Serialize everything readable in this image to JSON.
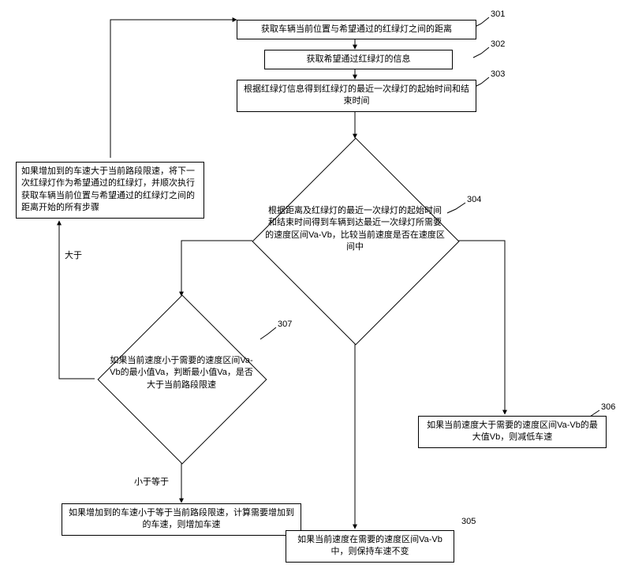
{
  "step301": {
    "num": "301",
    "text": "获取车辆当前位置与希望通过的红绿灯之间的距离"
  },
  "step302": {
    "num": "302",
    "text": "获取希望通过红绿灯的信息"
  },
  "step303": {
    "num": "303",
    "text": "根据红绿灯信息得到红绿灯的最近一次绿灯的起始时间和结束时间"
  },
  "step304": {
    "num": "304",
    "text": "根据距离及红绿灯的最近一次绿灯的起始时间和结束时间得到车辆到达最近一次绿灯所需要的速度区间Va-Vb，比较当前速度是否在速度区间中"
  },
  "step305": {
    "num": "305",
    "text": "如果当前速度在需要的速度区间Va-Vb中，则保持车速不变"
  },
  "step306": {
    "num": "306",
    "text": "如果当前速度大于需要的速度区间Va-Vb的最大值Vb，则减低车速"
  },
  "step307": {
    "num": "307",
    "text": "如果当前速度小于需要的速度区间Va-Vb的最小值Va，判断最小值Va，是否大于当前路段限速"
  },
  "loopback": "如果增加到的车速大于当前路段限速，将下一次红绿灯作为希望通过的红绿灯，并顺次执行获取车辆当前位置与希望通过的红绿灯之间的距离开始的所有步骤",
  "increase": "如果增加到的车速小于等于当前路段限速，计算需要增加到的车速，则增加车速",
  "edge_greater": "大于",
  "edge_leq": "小于等于"
}
